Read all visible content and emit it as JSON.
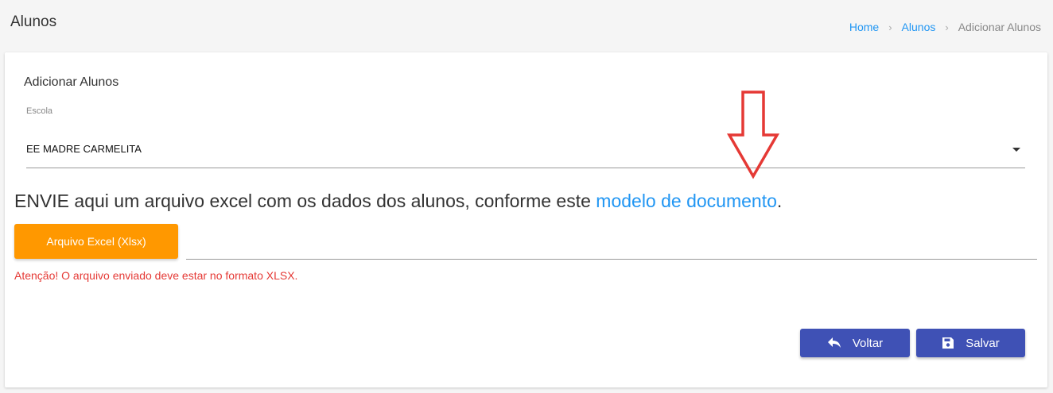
{
  "header": {
    "title": "Alunos",
    "breadcrumb": {
      "home": "Home",
      "alunos": "Alunos",
      "current": "Adicionar Alunos",
      "separator": "›"
    }
  },
  "form": {
    "title": "Adicionar Alunos",
    "school_label": "Escola",
    "school_value": "EE MADRE CARMELITA",
    "instruction_text": "ENVIE aqui um arquivo excel com os dados dos alunos, conforme este ",
    "instruction_link": "modelo de documento",
    "instruction_end": ".",
    "upload_button": "Arquivo Excel (Xlsx)",
    "warning": "Atenção! O arquivo enviado deve estar no formato XLSX."
  },
  "actions": {
    "back_label": "Voltar",
    "save_label": "Salvar"
  },
  "colors": {
    "accent_link": "#2196f3",
    "upload_button": "#ff9800",
    "primary_button": "#3f51b5",
    "warning_text": "#e53935",
    "annotation_arrow": "#e53935"
  },
  "icons": {
    "back": "reply-arrow-icon",
    "save": "floppy-disk-icon",
    "dropdown": "caret-down-icon",
    "annotation": "down-arrow-annotation-icon"
  }
}
